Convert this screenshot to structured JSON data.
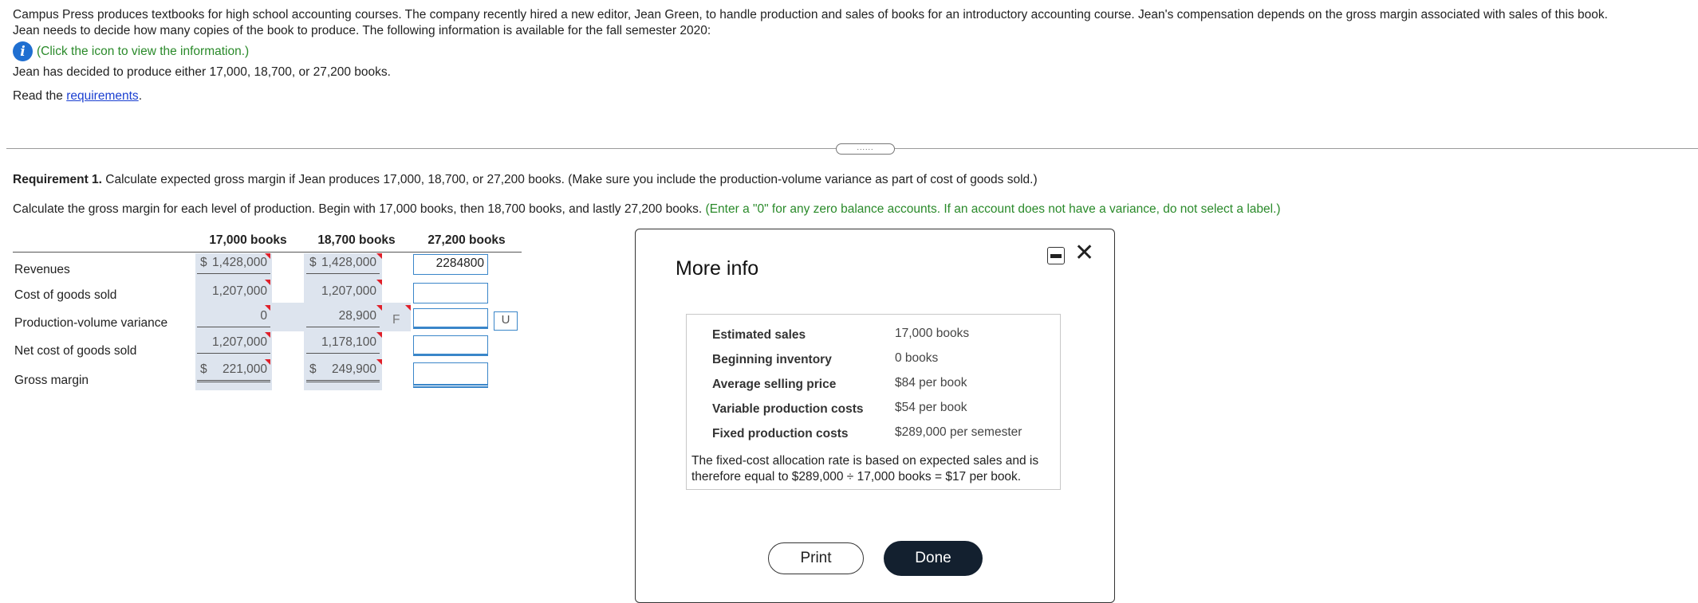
{
  "intro": {
    "paragraph_line1": "Campus Press produces textbooks for high school accounting courses. The company recently hired a new editor, Jean Green, to handle production and sales of books for an introductory accounting course. Jean's compensation depends on the gross margin associated with sales of this book.",
    "paragraph_line2": "Jean needs to decide how many copies of the book to produce. The following information is available for the fall semester 2020:",
    "info_link_text": "(Click the icon to view the information.)",
    "decision_text": "Jean has decided to produce either 17,000, 18,700, or 27,200 books.",
    "read_prefix": "Read the ",
    "requirements_link": "requirements",
    "read_suffix": "."
  },
  "requirement": {
    "label": "Requirement 1.",
    "text": " Calculate expected gross margin if Jean produces 17,000, 18,700, or 27,200 books. (Make sure you include the production-volume variance as part of cost of goods sold.)",
    "instruction": "Calculate the gross margin for each level of production. Begin with 17,000 books, then 18,700 books, and lastly 27,200 books.",
    "instruction_green": " (Enter a \"0\" for any zero balance accounts. If an account does not have a variance, do not select a label.)"
  },
  "handle_text": "......",
  "table": {
    "columns": [
      "17,000 books",
      "18,700 books",
      "27,200 books"
    ],
    "rows": [
      "Revenues",
      "Cost of goods sold",
      "Production-volume variance",
      "Net cost of goods sold",
      "Gross margin"
    ],
    "col1": {
      "revenues_symbol": "$",
      "revenues": "1,428,000",
      "cogs": "1,207,000",
      "pvv": "0",
      "net_cogs": "1,207,000",
      "gm_symbol": "$",
      "gm": "221,000"
    },
    "col2": {
      "revenues_symbol": "$",
      "revenues": "1,428,000",
      "cogs": "1,207,000",
      "pvv": "28,900",
      "pvv_label": "F",
      "net_cogs": "1,178,100",
      "gm_symbol": "$",
      "gm": "249,900"
    },
    "col3": {
      "revenues_input": "2284800",
      "cogs_input": "",
      "pvv_input": "",
      "pvv_label": "U",
      "net_cogs_input": "",
      "gm_input": ""
    }
  },
  "modal": {
    "title": "More info",
    "items": [
      {
        "label": "Estimated sales",
        "value": "17,000 books"
      },
      {
        "label": "Beginning inventory",
        "value": "0 books"
      },
      {
        "label": "Average selling price",
        "value": "$84 per book"
      },
      {
        "label": "Variable production costs",
        "value": "$54 per book"
      },
      {
        "label": "Fixed production costs",
        "value": "$289,000 per semester"
      }
    ],
    "note": "The fixed-cost allocation rate is based on expected sales and is therefore equal to $289,000 ÷ 17,000 books = $17 per book.",
    "print_label": "Print",
    "done_label": "Done",
    "close_symbol": "✕"
  },
  "colors": {
    "link": "#1a3fd1",
    "hint_green": "#2a8a2a",
    "input_border": "#3a86c9",
    "done_button": "#13202f",
    "answer_shade": "#dde4ee",
    "marker_red": "#e0202a"
  }
}
